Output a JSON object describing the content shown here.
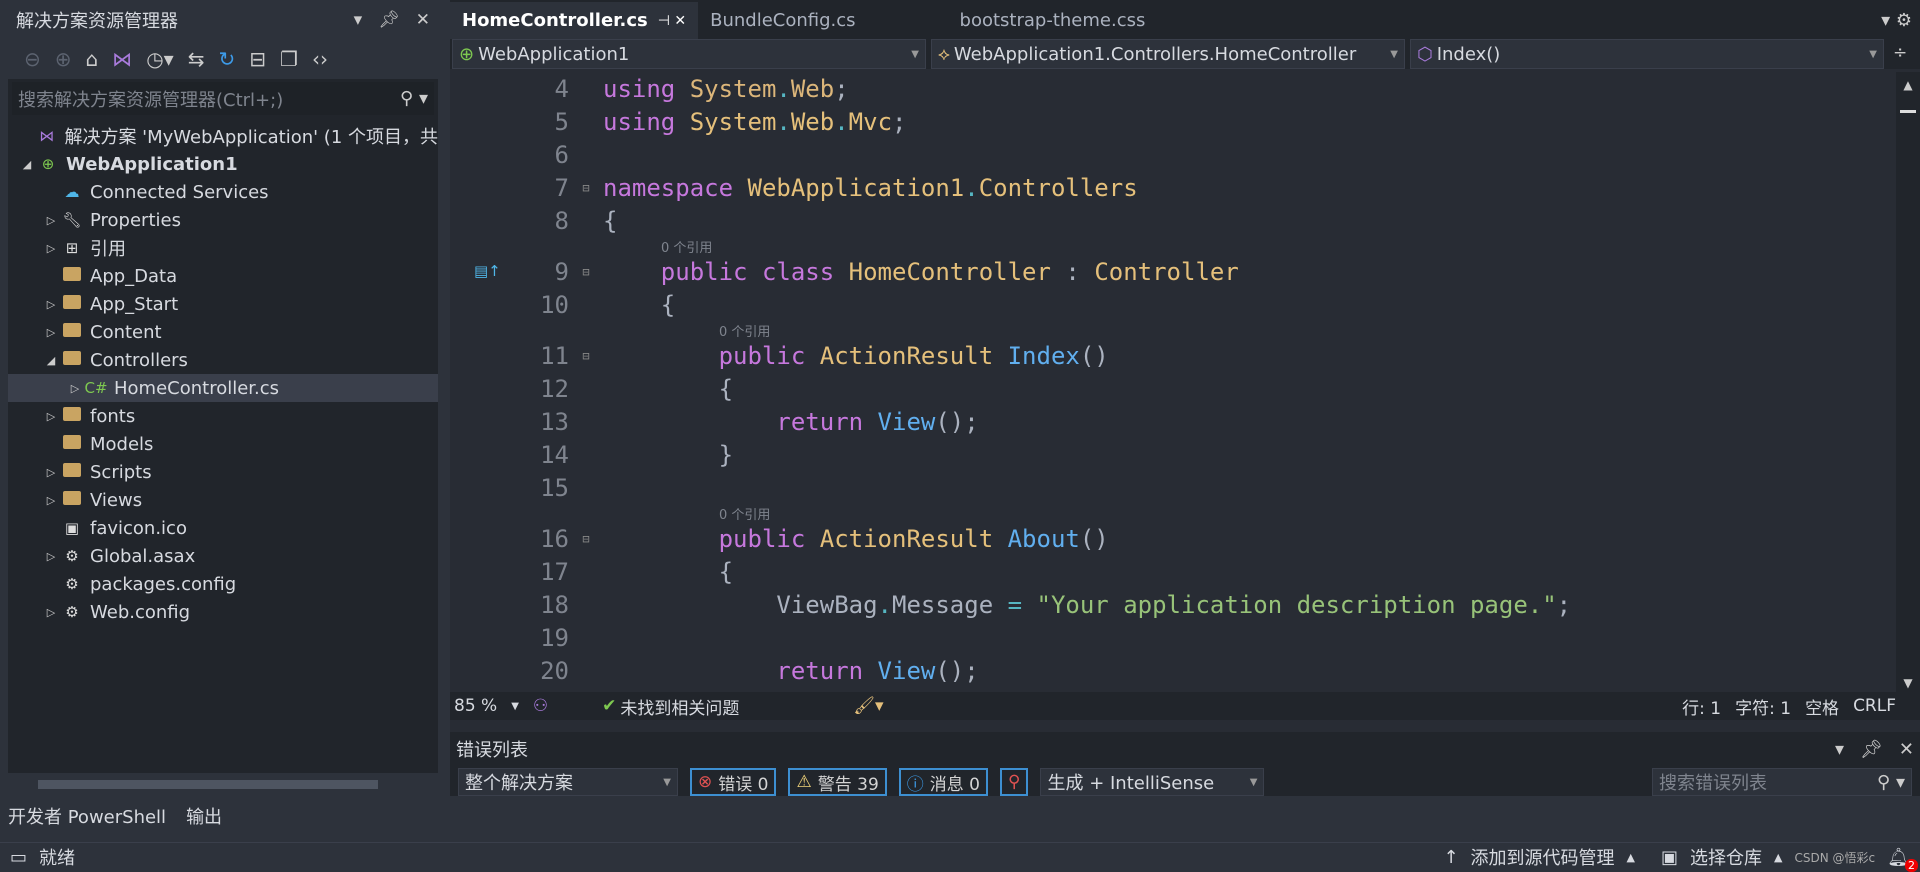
{
  "solution_explorer": {
    "title": "解决方案资源管理器",
    "search_placeholder": "搜索解决方案资源管理器(Ctrl+;)",
    "tree": [
      {
        "label": "解决方案 'MyWebApplication' (1 个项目，共",
        "level": 0,
        "exp": "",
        "icon": "solution-icon",
        "bold": false
      },
      {
        "label": "WebApplication1",
        "level": 0,
        "exp": "◢",
        "icon": "web-project-icon",
        "bold": true
      },
      {
        "label": "Connected Services",
        "level": 1,
        "exp": "",
        "icon": "cloud-icon"
      },
      {
        "label": "Properties",
        "level": 1,
        "exp": "▷",
        "icon": "wrench-icon"
      },
      {
        "label": "引用",
        "level": 1,
        "exp": "▷",
        "icon": "references-icon"
      },
      {
        "label": "App_Data",
        "level": 1,
        "exp": "",
        "icon": "folder-icon"
      },
      {
        "label": "App_Start",
        "level": 1,
        "exp": "▷",
        "icon": "folder-icon"
      },
      {
        "label": "Content",
        "level": 1,
        "exp": "▷",
        "icon": "folder-icon"
      },
      {
        "label": "Controllers",
        "level": 1,
        "exp": "◢",
        "icon": "folder-icon"
      },
      {
        "label": "HomeController.cs",
        "level": 2,
        "exp": "▷",
        "icon": "csharp-file-icon",
        "selected": true
      },
      {
        "label": "fonts",
        "level": 1,
        "exp": "▷",
        "icon": "folder-icon"
      },
      {
        "label": "Models",
        "level": 1,
        "exp": "",
        "icon": "folder-icon"
      },
      {
        "label": "Scripts",
        "level": 1,
        "exp": "▷",
        "icon": "folder-icon"
      },
      {
        "label": "Views",
        "level": 1,
        "exp": "▷",
        "icon": "folder-icon"
      },
      {
        "label": "favicon.ico",
        "level": 1,
        "exp": "",
        "icon": "image-file-icon"
      },
      {
        "label": "Global.asax",
        "level": 1,
        "exp": "▷",
        "icon": "config-file-icon"
      },
      {
        "label": "packages.config",
        "level": 1,
        "exp": "",
        "icon": "config-file-icon"
      },
      {
        "label": "Web.config",
        "level": 1,
        "exp": "▷",
        "icon": "config-file-icon"
      }
    ]
  },
  "editor": {
    "tabs": [
      {
        "label": "HomeController.cs",
        "active": true
      },
      {
        "label": "BundleConfig.cs"
      },
      {
        "label": "bootstrap-theme.css"
      }
    ],
    "nav": {
      "project": "WebApplication1",
      "type": "WebApplication1.Controllers.HomeController",
      "member": "Index()"
    },
    "lines": [
      {
        "n": "4",
        "tokens": [
          [
            "k",
            "using"
          ],
          [
            "txt",
            " "
          ],
          [
            "n",
            "System"
          ],
          [
            "p",
            "."
          ],
          [
            "n",
            "Web"
          ],
          [
            "txt",
            ";"
          ]
        ]
      },
      {
        "n": "5",
        "tokens": [
          [
            "k",
            "using"
          ],
          [
            "txt",
            " "
          ],
          [
            "t",
            "System"
          ],
          [
            "p",
            "."
          ],
          [
            "t",
            "Web"
          ],
          [
            "p",
            "."
          ],
          [
            "t",
            "Mvc"
          ],
          [
            "txt",
            ";"
          ]
        ]
      },
      {
        "n": "6",
        "tokens": []
      },
      {
        "n": "7",
        "fold": "⊟",
        "tokens": [
          [
            "k",
            "namespace"
          ],
          [
            "txt",
            " "
          ],
          [
            "t",
            "WebApplication1"
          ],
          [
            "p",
            "."
          ],
          [
            "t",
            "Controllers"
          ]
        ]
      },
      {
        "n": "8",
        "tokens": [
          [
            "txt",
            "{"
          ]
        ]
      },
      {
        "lens": "0 个引用",
        "indent": 1
      },
      {
        "n": "9",
        "fold": "⊟",
        "tokens": [
          [
            "txt",
            "    "
          ],
          [
            "k",
            "public"
          ],
          [
            "txt",
            " "
          ],
          [
            "k",
            "class"
          ],
          [
            "txt",
            " "
          ],
          [
            "t",
            "HomeController"
          ],
          [
            "txt",
            " : "
          ],
          [
            "t",
            "Controller"
          ]
        ]
      },
      {
        "n": "10",
        "tokens": [
          [
            "txt",
            "    {"
          ]
        ]
      },
      {
        "lens": "0 个引用",
        "indent": 2
      },
      {
        "n": "11",
        "fold": "⊟",
        "tokens": [
          [
            "txt",
            "        "
          ],
          [
            "k",
            "public"
          ],
          [
            "txt",
            " "
          ],
          [
            "t",
            "ActionResult"
          ],
          [
            "txt",
            " "
          ],
          [
            "m",
            "Index"
          ],
          [
            "txt",
            "()"
          ]
        ]
      },
      {
        "n": "12",
        "tokens": [
          [
            "txt",
            "        {"
          ]
        ]
      },
      {
        "n": "13",
        "tokens": [
          [
            "txt",
            "            "
          ],
          [
            "k",
            "return"
          ],
          [
            "txt",
            " "
          ],
          [
            "m",
            "View"
          ],
          [
            "txt",
            "();"
          ]
        ]
      },
      {
        "n": "14",
        "tokens": [
          [
            "txt",
            "        }"
          ]
        ]
      },
      {
        "n": "15",
        "tokens": []
      },
      {
        "lens": "0 个引用",
        "indent": 2
      },
      {
        "n": "16",
        "fold": "⊟",
        "tokens": [
          [
            "txt",
            "        "
          ],
          [
            "k",
            "public"
          ],
          [
            "txt",
            " "
          ],
          [
            "t",
            "ActionResult"
          ],
          [
            "txt",
            " "
          ],
          [
            "m",
            "About"
          ],
          [
            "txt",
            "()"
          ]
        ]
      },
      {
        "n": "17",
        "tokens": [
          [
            "txt",
            "        {"
          ]
        ]
      },
      {
        "n": "18",
        "tokens": [
          [
            "txt",
            "            ViewBag"
          ],
          [
            "p",
            "."
          ],
          [
            "txt",
            "Message "
          ],
          [
            "p",
            "="
          ],
          [
            "txt",
            " "
          ],
          [
            "s",
            "\"Your application description page.\""
          ],
          [
            "txt",
            ";"
          ]
        ]
      },
      {
        "n": "19",
        "tokens": []
      },
      {
        "n": "20",
        "tokens": [
          [
            "txt",
            "            "
          ],
          [
            "k",
            "return"
          ],
          [
            "txt",
            " "
          ],
          [
            "m",
            "View"
          ],
          [
            "txt",
            "();"
          ]
        ]
      }
    ],
    "status": {
      "zoom": "85 %",
      "issues": "未找到相关问题",
      "line": "行: 1",
      "char": "字符: 1",
      "indent": "空格",
      "eol": "CRLF"
    }
  },
  "error_list": {
    "title": "错误列表",
    "scope": "整个解决方案",
    "errors": "错误 0",
    "warnings": "警告 39",
    "messages": "消息 0",
    "source": "生成 + IntelliSense",
    "search_placeholder": "搜索错误列表"
  },
  "bottom_tabs": [
    "开发者 PowerShell",
    "输出"
  ],
  "statusbar": {
    "ready": "就绪",
    "source_control": "添加到源代码管理",
    "repo": "选择仓库",
    "notifications": "2",
    "watermark": "CSDN @悟彩c"
  },
  "colors": {
    "keyword": "#c678dd",
    "type": "#e5c07b",
    "method": "#61afef",
    "string": "#98c379",
    "background": "#282c34"
  }
}
